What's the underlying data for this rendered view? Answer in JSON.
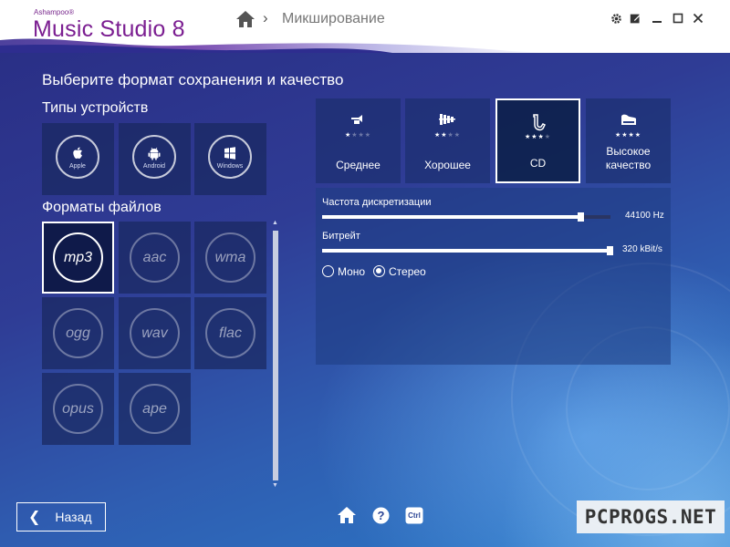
{
  "app": {
    "brand_small": "Ashampoo®",
    "brand_name": "Music Studio 8",
    "breadcrumb": "Микширование"
  },
  "window_buttons": [
    "gear-icon",
    "edit-icon",
    "minimize-icon",
    "maximize-icon",
    "close-icon"
  ],
  "main": {
    "heading": "Выберите формат сохранения и качество",
    "devices_label": "Типы устройств",
    "devices": [
      {
        "label": "Apple",
        "icon": "apple-icon"
      },
      {
        "label": "Android",
        "icon": "android-icon"
      },
      {
        "label": "Windows",
        "icon": "windows-icon"
      }
    ],
    "formats_label": "Форматы файлов",
    "formats": [
      "mp3",
      "aac",
      "wma",
      "ogg",
      "wav",
      "flac",
      "opus",
      "ape"
    ],
    "selected_format": "mp3"
  },
  "quality": {
    "options": [
      {
        "label": "Среднее",
        "stars_on": "★",
        "stars_off": "★★★",
        "icon": "trumpet-icon"
      },
      {
        "label": "Хорошее",
        "stars_on": "★★",
        "stars_off": "★★",
        "icon": "xylophone-icon"
      },
      {
        "label": "CD",
        "stars_on": "★★★",
        "stars_off": "★",
        "icon": "saxophone-icon"
      },
      {
        "label": "Высокое качество",
        "stars_on": "★★★★",
        "stars_off": "",
        "icon": "piano-icon"
      }
    ],
    "selected": "CD"
  },
  "settings": {
    "sample_rate_label": "Частота дискретизации",
    "sample_rate_value": "44100 Hz",
    "sample_rate_fraction": 0.9,
    "bitrate_label": "Битрейт",
    "bitrate_value": "320 kBit/s",
    "bitrate_fraction": 1.0,
    "mono_label": "Моно",
    "stereo_label": "Стерео",
    "channel_selected": "stereo"
  },
  "footer": {
    "back_label": "Назад",
    "icons": [
      "home-icon",
      "help-icon",
      "ctrl-icon"
    ],
    "ctrl_text": "Ctrl"
  },
  "watermark": "PCPROGS.NET",
  "colors": {
    "brand": "#7b1e91",
    "bg_top": "#2a2f86",
    "bg_bottom": "#2b7bc8"
  }
}
